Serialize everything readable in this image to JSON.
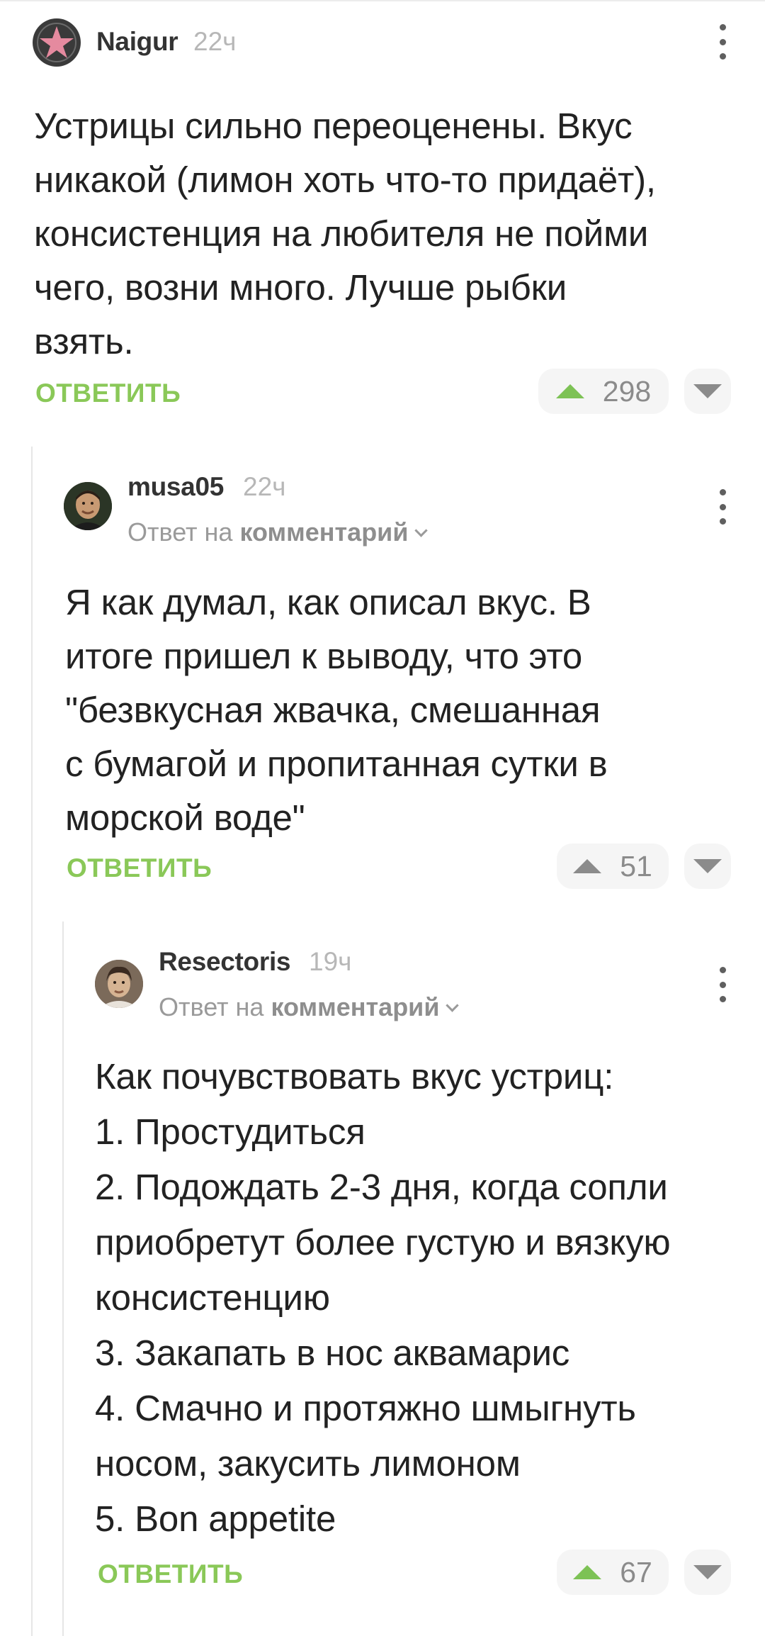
{
  "comments": [
    {
      "author": "Naigur",
      "time": "22ч",
      "text": "Устрицы сильно переоценены. Вкус\nникакой (лимон хоть что-то придаёт),\nконсистенция на любителя не пойми\nчего, возни много. Лучше рыбки\nвзять.",
      "reply_label": "ОТВЕТИТЬ",
      "rating": "298",
      "avatar_icon": "star-badge-avatar"
    },
    {
      "author": "musa05",
      "time": "22ч",
      "reply_to_prefix": "Ответ на",
      "reply_to_target": "комментарий",
      "text": "Я как думал, как описал вкус. В\nитоге пришел к выводу, что это\n\"безвкусная жвачка, смешанная\nс бумагой и пропитанная сутки в\nморской воде\"",
      "reply_label": "ОТВЕТИТЬ",
      "rating": "51",
      "avatar_icon": "user-photo-avatar"
    },
    {
      "author": "Resectoris",
      "time": "19ч",
      "reply_to_prefix": "Ответ на",
      "reply_to_target": "комментарий",
      "lines": [
        "Как почувствовать вкус устриц:",
        "1. Простудиться",
        "2. Подождать 2-3 дня, когда сопли",
        "приобретут более густую и вязкую",
        "консистенцию",
        "3. Закапать в нос аквамарис",
        "4. Смачно и протяжно шмыгнуть",
        "носом, закусить лимоном",
        "5. Bon appetite"
      ],
      "reply_label": "ОТВЕТИТЬ",
      "rating": "67",
      "avatar_icon": "user-photo-avatar"
    }
  ],
  "colors": {
    "accent_green": "#8ac858",
    "upvote_active": "#7dc255",
    "muted": "#9a9a9a"
  }
}
